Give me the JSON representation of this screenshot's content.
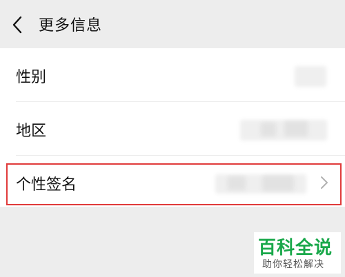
{
  "header": {
    "back_icon": "chevron-left-icon",
    "title": "更多信息"
  },
  "rows": [
    {
      "label": "性别"
    },
    {
      "label": "地区"
    },
    {
      "label": "个性签名",
      "chevron_icon": "chevron-right-icon"
    }
  ],
  "watermark": {
    "title": "百科全说",
    "subtitle": "助你轻松解决"
  },
  "colors": {
    "background": "#ededed",
    "list_background": "#ffffff",
    "highlight_border": "#e03a3a",
    "watermark_green": "#19a84a"
  }
}
